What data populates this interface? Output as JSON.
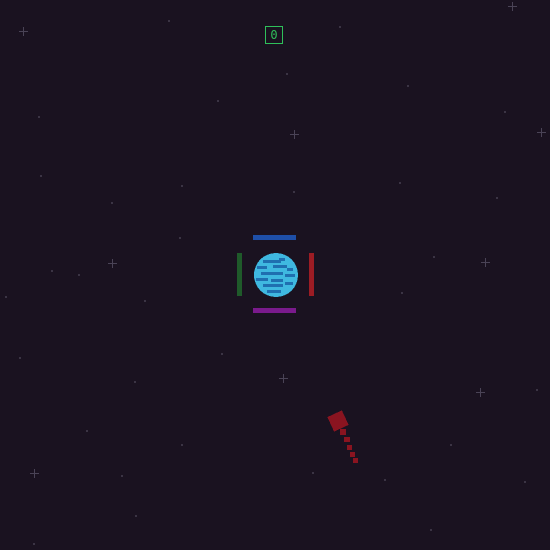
{
  "game": {
    "score": "0"
  },
  "colors": {
    "background": "#1a1220",
    "score_green": "#2fbf5a",
    "shield_top": "#1e4fa8",
    "shield_bottom": "#7a1a8c",
    "shield_left": "#1f5a2a",
    "shield_right": "#9c1c24",
    "planet_light": "#3fb8e0",
    "planet_dark": "#1f6fb0",
    "meteor": "#8a1420"
  },
  "icons": {
    "planet": "planet-icon",
    "meteor": "meteor-icon",
    "star": "star-icon"
  }
}
